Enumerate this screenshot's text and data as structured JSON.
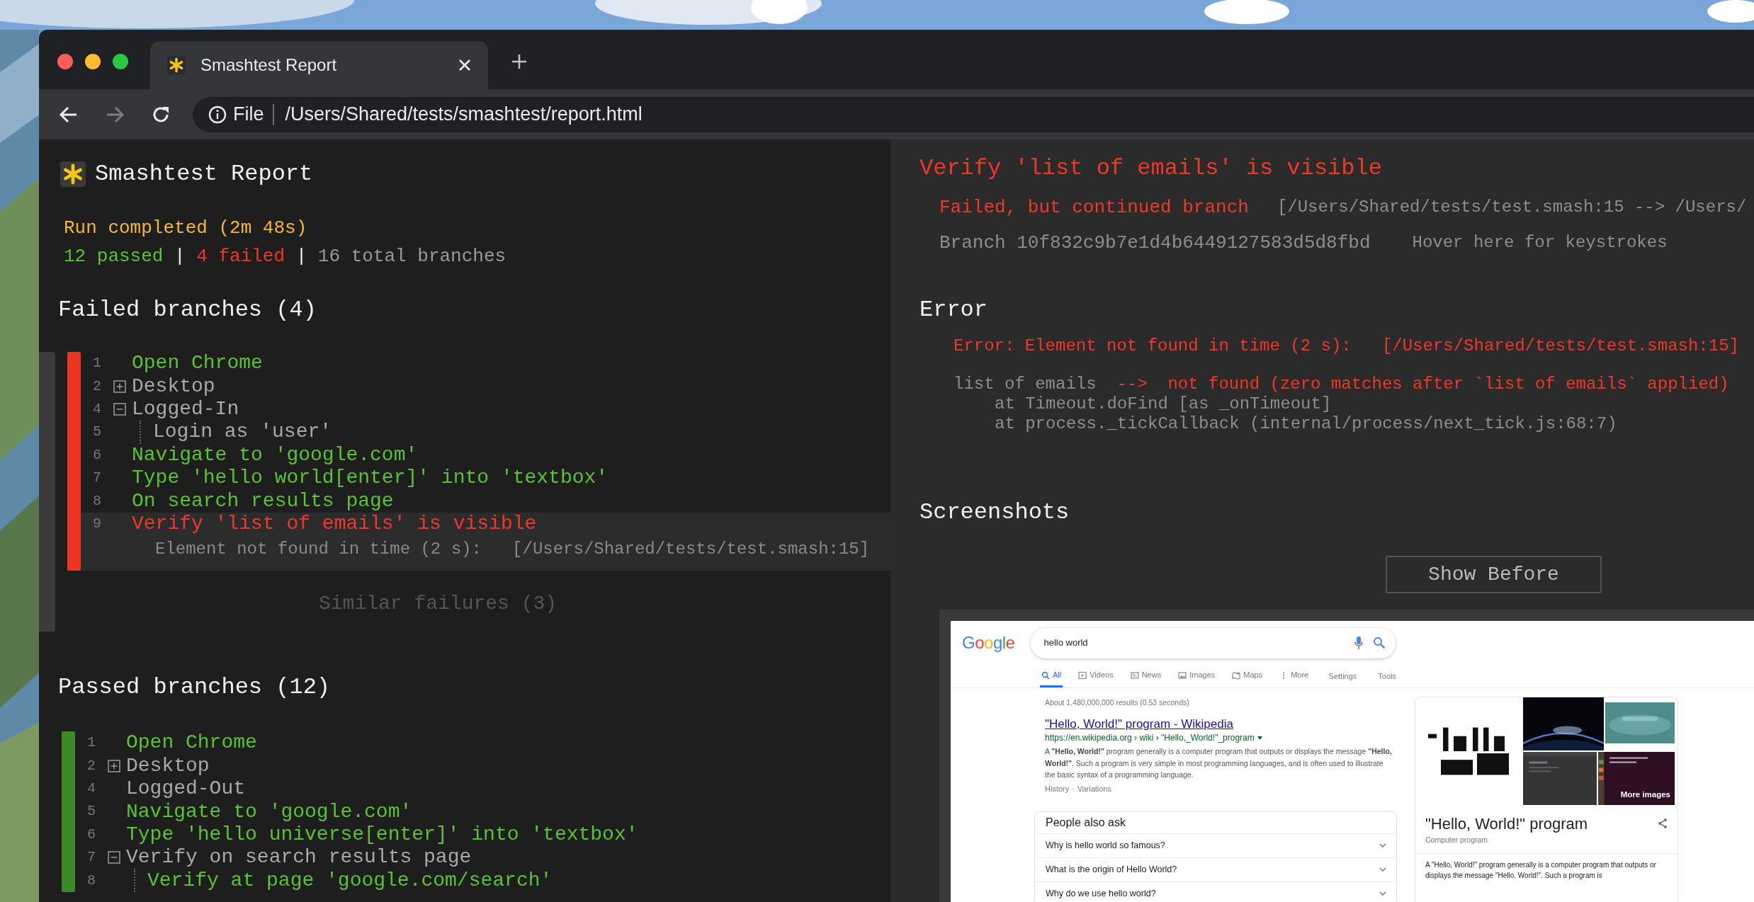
{
  "browser": {
    "tab": {
      "title": "Smashtest Report"
    },
    "forward_enabled": false,
    "address": {
      "scheme": "File",
      "path": "/Users/Shared/tests/smashtest/report.html"
    }
  },
  "report": {
    "title": "Smashtest Report",
    "run_status": "Run completed (2m 48s)",
    "summary": [
      {
        "kind": "passed",
        "text": "12 passed"
      },
      {
        "kind": "separator",
        "text": "|"
      },
      {
        "kind": "failed",
        "text": "4 failed"
      },
      {
        "kind": "separator",
        "text": "|"
      },
      {
        "kind": "total",
        "text": "16 total branches"
      }
    ],
    "sections": [
      {
        "heading": "Failed branches (4)",
        "footer": "Similar failures (3)",
        "branches": [
          {
            "kind": "failed",
            "selected": true,
            "steps": [
              {
                "line": "1",
                "text": "Open Chrome",
                "kind": "passed"
              },
              {
                "line": "2",
                "text": "Desktop",
                "kind": "group",
                "expanded": false
              },
              {
                "line": "4",
                "text": "Logged-In",
                "kind": "group",
                "expanded": true,
                "children": [
                  {
                    "line": "5",
                    "text": "Login as 'user'",
                    "kind": "group"
                  }
                ]
              },
              {
                "line": "6",
                "text": "Navigate to 'google.com'",
                "kind": "passed"
              },
              {
                "line": "7",
                "text": "Type 'hello world[enter]' into 'textbox'",
                "kind": "passed"
              },
              {
                "line": "8",
                "text": "On search results page",
                "kind": "passed"
              },
              {
                "line": "9",
                "text": "Verify 'list of emails' is visible",
                "kind": "failed",
                "error": "Element not found in time (2 s):   [/Users/Shared/tests/test.smash:15]"
              }
            ]
          }
        ]
      },
      {
        "heading": "Passed branches (12)",
        "branches": [
          {
            "kind": "passed",
            "selected": false,
            "steps": [
              {
                "line": "1",
                "text": "Open Chrome",
                "kind": "passed"
              },
              {
                "line": "2",
                "text": "Desktop",
                "kind": "group",
                "expanded": false
              },
              {
                "line": "4",
                "text": "Logged-Out",
                "kind": "group"
              },
              {
                "line": "5",
                "text": "Navigate to 'google.com'",
                "kind": "passed"
              },
              {
                "line": "6",
                "text": "Type 'hello universe[enter]' into 'textbox'",
                "kind": "passed"
              },
              {
                "line": "7",
                "text": "Verify on search results page",
                "kind": "group",
                "expanded": true,
                "children": [
                  {
                    "line": "8",
                    "text": "Verify at page 'google.com/search'",
                    "kind": "passed"
                  }
                ]
              }
            ]
          }
        ]
      }
    ]
  },
  "detail": {
    "title": "Verify 'list of emails' is visible",
    "status": "Failed, but continued branch",
    "location": "[/Users/Shared/tests/test.smash:15 --> /Users/",
    "branch": "Branch 10f832c9b7e1d4b6449127583d5d8fbd",
    "hover_hint": "Hover here for keystrokes",
    "error_heading": "Error",
    "error_message": "Error: Element not found in time (2 s):   [/Users/Shared/tests/test.smash:15]",
    "error_detail": {
      "subject": "list of emails",
      "arrow": "-->",
      "result": "not found (zero matches after `list of emails` applied)"
    },
    "stack": [
      "at Timeout.doFind [as _onTimeout]",
      "at process._tickCallback (internal/process/next_tick.js:68:7)"
    ],
    "screenshots_heading": "Screenshots",
    "toggle_button": "Show Before",
    "screenshot": {
      "logo": "Google",
      "query": "hello world",
      "tabs": [
        {
          "label": "All",
          "selected": true
        },
        {
          "label": "Videos",
          "selected": false
        },
        {
          "label": "News",
          "selected": false
        },
        {
          "label": "Images",
          "selected": false
        },
        {
          "label": "Maps",
          "selected": false
        },
        {
          "label": "More",
          "selected": false
        }
      ],
      "tools": [
        "Settings",
        "Tools"
      ],
      "stats": "About 1,480,000,000 results (0.53 seconds)",
      "result": {
        "title": "\"Hello, World!\" program - Wikipedia",
        "url": "https://en.wikipedia.org › wiki › \"Hello,_World!\"_program",
        "snippet": "A **\"Hello, World!\"** program generally is a computer program that outputs or displays the message **\"Hello, World!\"**. Such a program is very simple in most programming languages, and is often used to illustrate the basic syntax of a programming language.",
        "links": [
          "History",
          "Variations"
        ],
        "link_separator": "·"
      },
      "people_also_ask": {
        "heading": "People also ask",
        "questions": [
          "Why is hello world so famous?",
          "What is the origin of Hello World?",
          "Why do we use hello world?"
        ]
      },
      "knowledge_panel": {
        "more_images": "More images",
        "title": "\"Hello, World!\" program",
        "subtitle": "Computer program",
        "description": "A \"Hello, World!\" program generally is a computer program that outputs or displays the message \"Hello, World!\". Such a program is"
      }
    }
  }
}
